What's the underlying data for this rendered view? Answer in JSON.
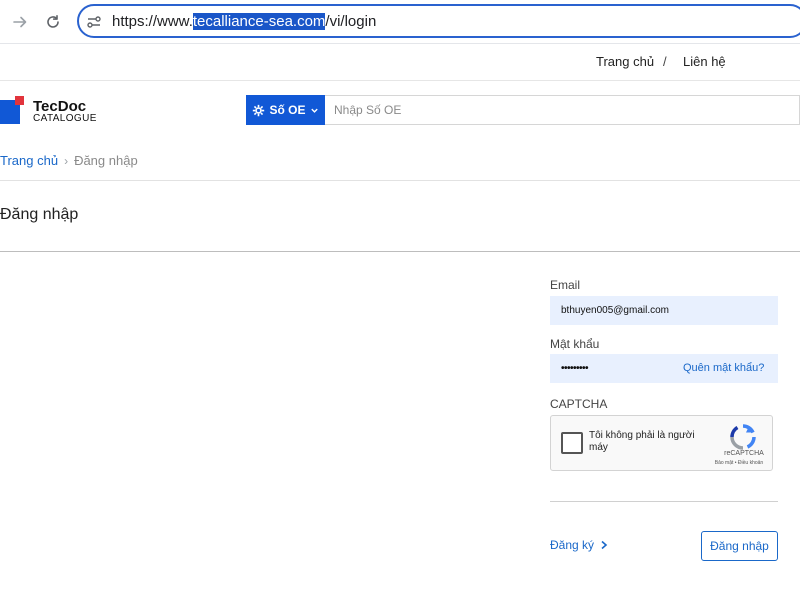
{
  "browser": {
    "url_prefix": "https://www.",
    "url_domain": "tecalliance-sea.com",
    "url_path": "/vi/login"
  },
  "topnav": {
    "home": "Trang chủ",
    "separator": "/",
    "contact": "Liên hệ"
  },
  "logo": {
    "title": "TecDoc",
    "subtitle": "CATALOGUE"
  },
  "search": {
    "button_label": "Số OE",
    "placeholder": "Nhập Số OE"
  },
  "breadcrumb": {
    "home": "Trang chủ",
    "separator": "›",
    "current": "Đăng nhập"
  },
  "page": {
    "title": "Đăng nhập"
  },
  "form": {
    "email_label": "Email",
    "email_value": "bthuyen005@gmail.com",
    "password_label": "Mật khẩu",
    "password_masked": "•••••••••",
    "forgot_label": "Quên mật khẩu?",
    "captcha_label": "CAPTCHA",
    "captcha_text": "Tôi không phải là người máy",
    "captcha_brand": "reCAPTCHA",
    "captcha_terms": "Bảo mật • Điều khoản",
    "register_label": "Đăng ký",
    "login_label": "Đăng nhập"
  },
  "colors": {
    "accent": "#1158d6",
    "link": "#1a68c9",
    "field_bg": "#e8f0fe",
    "logo_red": "#e2343c"
  }
}
